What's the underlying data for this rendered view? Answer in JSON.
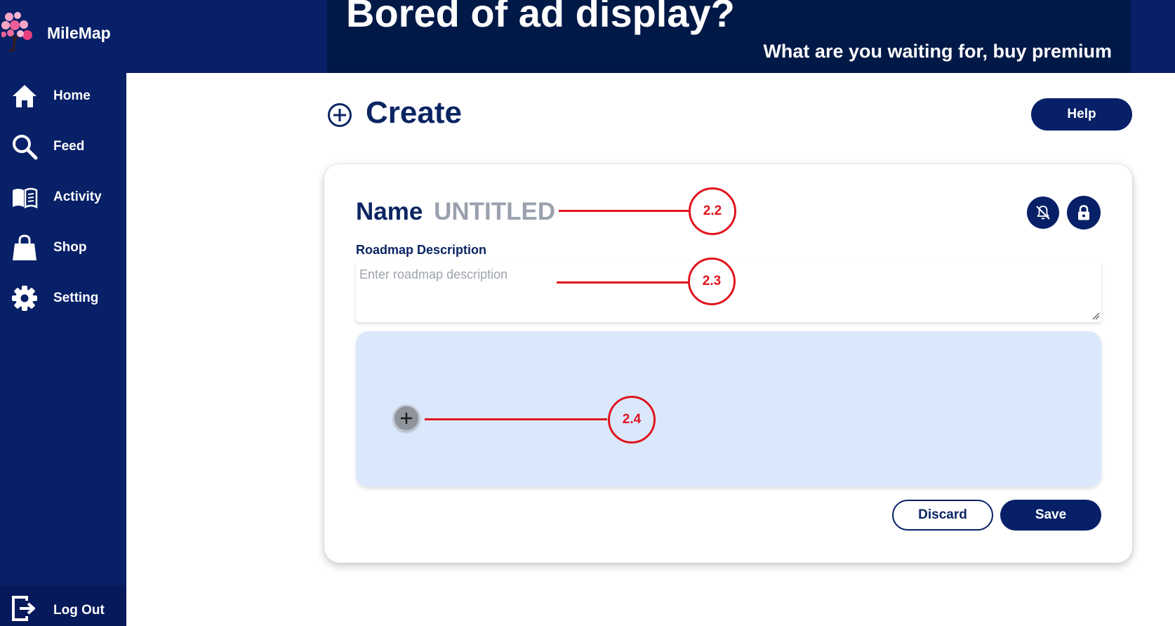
{
  "brand": {
    "name": "MileMap"
  },
  "sidebar": {
    "items": [
      {
        "label": "Home",
        "icon": "home-icon"
      },
      {
        "label": "Feed",
        "icon": "search-icon"
      },
      {
        "label": "Activity",
        "icon": "book-icon"
      },
      {
        "label": "Shop",
        "icon": "shopping-bag-icon"
      },
      {
        "label": "Setting",
        "icon": "gear-icon"
      }
    ],
    "logout_label": "Log Out"
  },
  "ad": {
    "title": "Bored of ad display?",
    "subtitle": "What are you waiting for, buy premium"
  },
  "page": {
    "title": "Create",
    "help_label": "Help"
  },
  "form": {
    "name_label": "Name",
    "name_value": "UNTITLED",
    "description_label": "Roadmap Description",
    "description_placeholder": "Enter roadmap description",
    "description_value": "",
    "discard_label": "Discard",
    "save_label": "Save"
  },
  "annotations": [
    {
      "label": "2.2"
    },
    {
      "label": "2.3"
    },
    {
      "label": "2.4"
    }
  ],
  "colors": {
    "navy": "#072067",
    "ad_background": "#011947",
    "milestone_area": "#dbe8fc",
    "annotation_red": "#e0141e",
    "placeholder_gray": "#9aa1ad"
  }
}
